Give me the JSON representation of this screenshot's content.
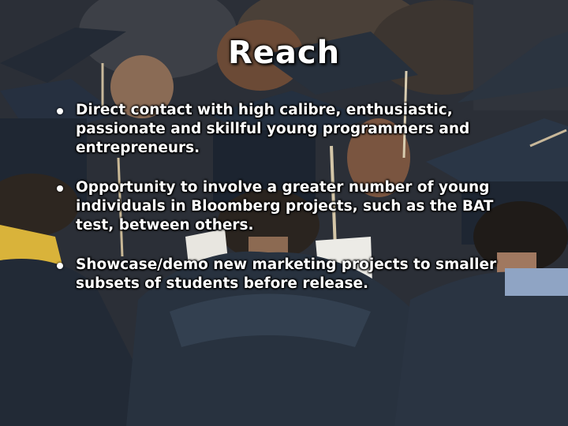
{
  "slide": {
    "title": "Reach",
    "bullets": [
      {
        "text": "Direct contact with high calibre, enthusiastic, passionate and skillful young programmers and entrepreneurs."
      },
      {
        "text": "Opportunity to involve a greater number of young individuals in Bloomberg projects, such as the BAT test, between others."
      },
      {
        "text": "Showcase/demo new marketing projects to smaller subsets of students before release."
      }
    ]
  }
}
